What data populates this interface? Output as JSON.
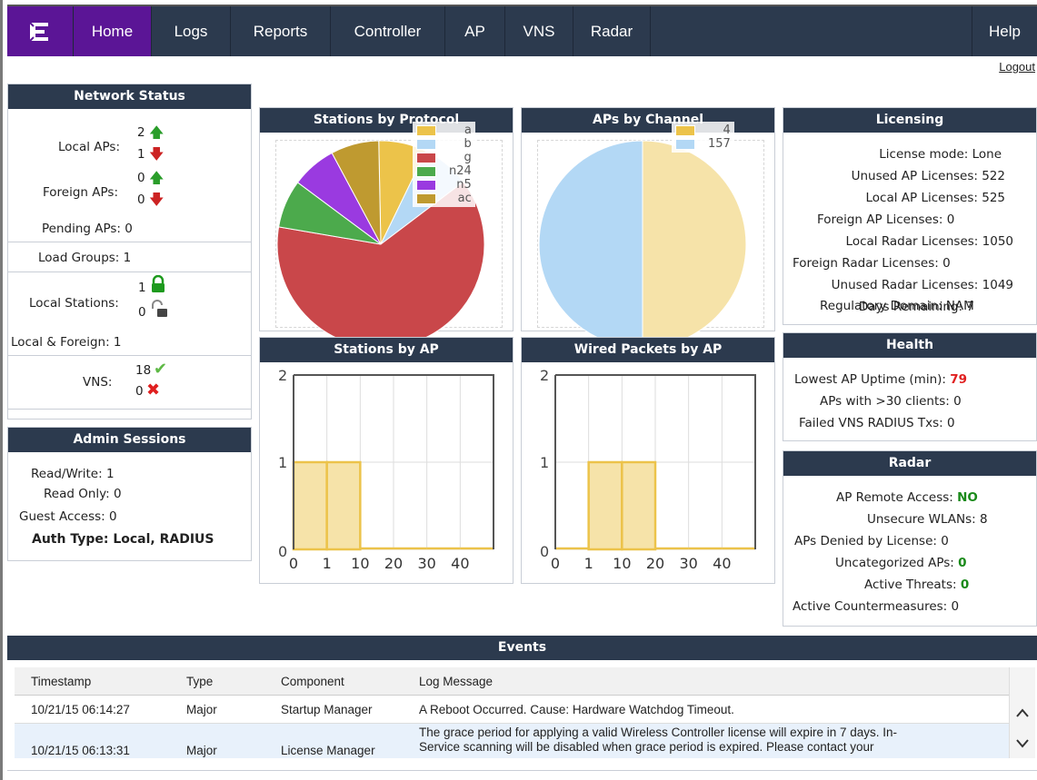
{
  "nav": {
    "items": [
      "Home",
      "Logs",
      "Reports",
      "Controller",
      "AP",
      "VNS",
      "Radar"
    ],
    "help": "Help",
    "logout": "Logout"
  },
  "network_status": {
    "title": "Network Status",
    "local_aps_label": "Local APs:",
    "local_aps_up": "2",
    "local_aps_down": "1",
    "foreign_aps_label": "Foreign APs:",
    "foreign_aps_up": "0",
    "foreign_aps_down": "0",
    "pending_aps": "Pending APs: 0",
    "load_groups": "Load Groups: 1",
    "local_stations_label": "Local Stations:",
    "local_stations_locked": "1",
    "local_stations_unlocked": "0",
    "local_foreign": "Local & Foreign: 1",
    "vns_label": "VNS:",
    "vns_ok": "18",
    "vns_err": "0"
  },
  "admin_sessions": {
    "title": "Admin Sessions",
    "read_write": "Read/Write: 1",
    "read_only": "Read Only: 0",
    "guest_access": "Guest Access: 0",
    "auth_type": "Auth Type: Local, RADIUS"
  },
  "stations_by_protocol": {
    "title": "Stations by Protocol",
    "legend": [
      {
        "label": "a",
        "color": "#ecc34a"
      },
      {
        "label": "b",
        "color": "#b3d8f5"
      },
      {
        "label": "g",
        "color": "#c9474a"
      },
      {
        "label": "n24",
        "color": "#4caa4c"
      },
      {
        "label": "n5",
        "color": "#9a3ae0"
      },
      {
        "label": "ac",
        "color": "#bf9a30"
      }
    ],
    "slices": [
      {
        "label": "a",
        "value": 0.075
      },
      {
        "label": "b",
        "value": 0.075
      },
      {
        "label": "g",
        "value": 0.63
      },
      {
        "label": "n24",
        "value": 0.075
      },
      {
        "label": "n5",
        "value": 0.07
      },
      {
        "label": "ac",
        "value": 0.075
      }
    ]
  },
  "aps_by_channel": {
    "title": "APs by Channel",
    "legend": [
      {
        "label": "4",
        "color": "#ecc34a"
      },
      {
        "label": "157",
        "color": "#b3d8f5"
      }
    ],
    "slices": [
      {
        "label": "4",
        "value": 0.5,
        "color": "#f6e3a9"
      },
      {
        "label": "157",
        "value": 0.5,
        "color": "#b3d8f5"
      }
    ]
  },
  "licensing": {
    "title": "Licensing",
    "rows": [
      "License mode: Lone",
      "Unused AP Licenses: 522",
      "Local AP Licenses: 525",
      "Foreign AP Licenses: 0",
      "Local Radar Licenses: 1050",
      "Foreign Radar Licenses: 0",
      "Unused Radar Licenses: 1049",
      "Days Remaining: 7",
      "Regulatory Domain: NAM"
    ]
  },
  "health": {
    "title": "Health",
    "uptime_label": "Lowest AP Uptime (min):",
    "uptime_value": "79",
    "clients": "APs with >30 clients: 0",
    "radius": "Failed VNS RADIUS Txs: 0"
  },
  "radar": {
    "title": "Radar",
    "remote_label": "AP Remote Access:",
    "remote_value": "NO",
    "unsecure": "Unsecure WLANs: 8",
    "denied": "APs Denied by License: 0",
    "uncat_label": "Uncategorized APs:",
    "uncat_value": "0",
    "threats_label": "Active Threats:",
    "threats_value": "0",
    "counter": "Active Countermeasures: 0"
  },
  "chart_data": [
    {
      "type": "bar",
      "title": "Stations by AP",
      "categories": [
        "0",
        "1",
        "10",
        "20",
        "30",
        "40"
      ],
      "values": [
        1,
        1,
        0,
        0,
        0,
        0
      ],
      "ylim": [
        0,
        2
      ],
      "yticks": [
        "0",
        "1",
        "2"
      ]
    },
    {
      "type": "bar",
      "title": "Wired Packets by AP",
      "categories": [
        "0",
        "1",
        "10",
        "20",
        "30",
        "40"
      ],
      "values": [
        0,
        1,
        1,
        0,
        0,
        0
      ],
      "ylim": [
        0,
        2
      ],
      "yticks": [
        "0",
        "1",
        "2"
      ]
    }
  ],
  "events": {
    "title": "Events",
    "columns": [
      "Timestamp",
      "Type",
      "Component",
      "Log Message"
    ],
    "rows": [
      {
        "timestamp": "10/21/15 06:14:27",
        "type": "Major",
        "component": "Startup Manager",
        "message1": "A Reboot Occurred. Cause: Hardware Watchdog Timeout.",
        "message2": ""
      },
      {
        "timestamp": "10/21/15 06:13:31",
        "type": "Major",
        "component": "License Manager",
        "message1": "The grace period for applying a valid Wireless Controller license will expire in 7 days. In-",
        "message2": "Service scanning will be disabled when grace period is expired. Please contact your"
      }
    ]
  }
}
